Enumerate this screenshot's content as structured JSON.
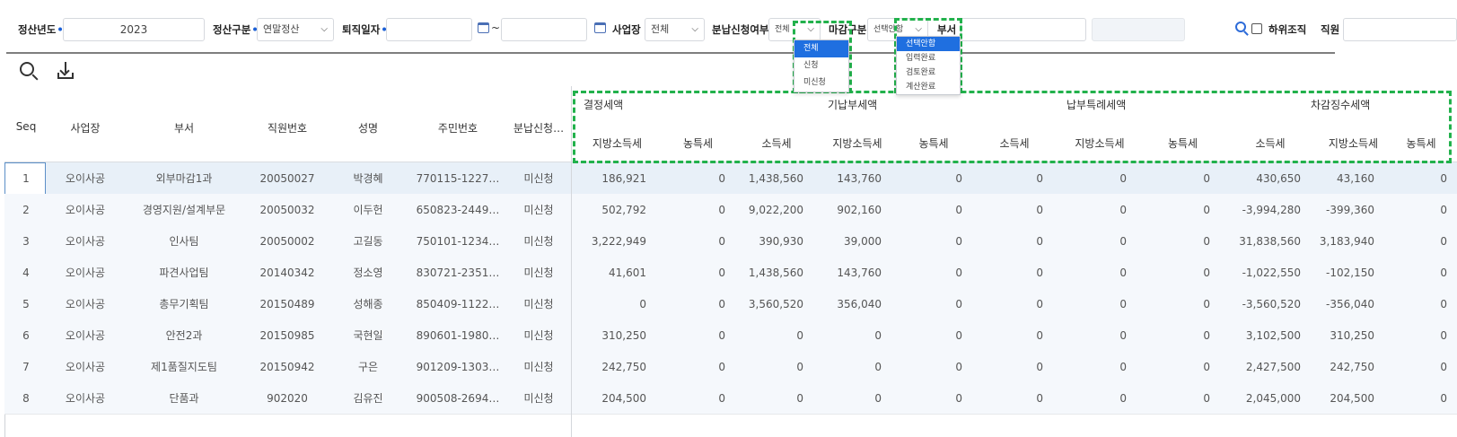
{
  "filters": {
    "year_label": "정산년도",
    "year_value": "2023",
    "type_label": "정산구분",
    "type_value": "연말정산",
    "retire_label": "퇴직일자",
    "tilde": "~",
    "site_label": "사업장",
    "site_value": "전체",
    "installment_label": "분납신청여부",
    "installment_value": "전체",
    "installment_options": [
      "전체",
      "신청",
      "미신청"
    ],
    "closing_label": "마감구분",
    "closing_value": "선택안함",
    "closing_options": [
      "선택안함",
      "입력완료",
      "검토완료",
      "계산완료"
    ],
    "dept_label": "부서",
    "sub_org_label": "하위조직",
    "employee_label": "직원"
  },
  "icons": {
    "search": "search-icon",
    "download": "download-icon",
    "calendar": "calendar-icon",
    "chevron": "chevron-down-icon"
  },
  "colors": {
    "accent": "#1f6fe0",
    "required_dot": "#1a5fd6",
    "highlight_box": "#22b14c"
  },
  "grid": {
    "headers": {
      "seq": "Seq",
      "site": "사업장",
      "dept": "부서",
      "emp_no": "직원번호",
      "name": "성명",
      "rrn": "주민번호",
      "installment": "분납신청…",
      "group_determined": "결정세액",
      "group_prepaid": "기납부세액",
      "group_special": "납부특례세액",
      "group_deduct": "차감징수세액",
      "local_tax": "지방소득세",
      "rural_tax": "농특세",
      "income_tax": "소득세"
    },
    "rows": [
      {
        "seq": "1",
        "site": "오이사공",
        "dept": "외부마감1과",
        "emp_no": "20050027",
        "name": "박경혜",
        "rrn": "770115-1227…",
        "installment": "미신청",
        "d_local": "186,921",
        "d_rural": "0",
        "p_income": "1,438,560",
        "p_local": "143,760",
        "p_rural": "0",
        "s_income": "0",
        "s_local": "0",
        "s_rural": "0",
        "x_income": "430,650",
        "x_local": "43,160",
        "x_rural": "0"
      },
      {
        "seq": "2",
        "site": "오이사공",
        "dept": "경영지원/설계부문",
        "emp_no": "20050032",
        "name": "이두헌",
        "rrn": "650823-2449…",
        "installment": "미신청",
        "d_local": "502,792",
        "d_rural": "0",
        "p_income": "9,022,200",
        "p_local": "902,160",
        "p_rural": "0",
        "s_income": "0",
        "s_local": "0",
        "s_rural": "0",
        "x_income": "-3,994,280",
        "x_local": "-399,360",
        "x_rural": "0"
      },
      {
        "seq": "3",
        "site": "오이사공",
        "dept": "인사팀",
        "emp_no": "20050002",
        "name": "고길동",
        "rrn": "750101-1234…",
        "installment": "미신청",
        "d_local": "3,222,949",
        "d_rural": "0",
        "p_income": "390,930",
        "p_local": "39,000",
        "p_rural": "0",
        "s_income": "0",
        "s_local": "0",
        "s_rural": "0",
        "x_income": "31,838,560",
        "x_local": "3,183,940",
        "x_rural": "0"
      },
      {
        "seq": "4",
        "site": "오이사공",
        "dept": "파견사업팀",
        "emp_no": "20140342",
        "name": "정소영",
        "rrn": "830721-2351…",
        "installment": "미신청",
        "d_local": "41,601",
        "d_rural": "0",
        "p_income": "1,438,560",
        "p_local": "143,760",
        "p_rural": "0",
        "s_income": "0",
        "s_local": "0",
        "s_rural": "0",
        "x_income": "-1,022,550",
        "x_local": "-102,150",
        "x_rural": "0"
      },
      {
        "seq": "5",
        "site": "오이사공",
        "dept": "총무기획팀",
        "emp_no": "20150489",
        "name": "성해종",
        "rrn": "850409-1122…",
        "installment": "미신청",
        "d_local": "0",
        "d_rural": "0",
        "p_income": "3,560,520",
        "p_local": "356,040",
        "p_rural": "0",
        "s_income": "0",
        "s_local": "0",
        "s_rural": "0",
        "x_income": "-3,560,520",
        "x_local": "-356,040",
        "x_rural": "0"
      },
      {
        "seq": "6",
        "site": "오이사공",
        "dept": "안전2과",
        "emp_no": "20150985",
        "name": "국현일",
        "rrn": "890601-1980…",
        "installment": "미신청",
        "d_local": "310,250",
        "d_rural": "0",
        "p_income": "0",
        "p_local": "0",
        "p_rural": "0",
        "s_income": "0",
        "s_local": "0",
        "s_rural": "0",
        "x_income": "3,102,500",
        "x_local": "310,250",
        "x_rural": "0"
      },
      {
        "seq": "7",
        "site": "오이사공",
        "dept": "제1품질지도팀",
        "emp_no": "20150942",
        "name": "구은",
        "rrn": "901209-1303…",
        "installment": "미신청",
        "d_local": "242,750",
        "d_rural": "0",
        "p_income": "0",
        "p_local": "0",
        "p_rural": "0",
        "s_income": "0",
        "s_local": "0",
        "s_rural": "0",
        "x_income": "2,427,500",
        "x_local": "242,750",
        "x_rural": "0"
      },
      {
        "seq": "8",
        "site": "오이사공",
        "dept": "단품과",
        "emp_no": "902020",
        "name": "김유진",
        "rrn": "900508-2694…",
        "installment": "미신청",
        "d_local": "204,500",
        "d_rural": "0",
        "p_income": "0",
        "p_local": "0",
        "p_rural": "0",
        "s_income": "0",
        "s_local": "0",
        "s_rural": "0",
        "x_income": "2,045,000",
        "x_local": "204,500",
        "x_rural": "0"
      }
    ]
  }
}
